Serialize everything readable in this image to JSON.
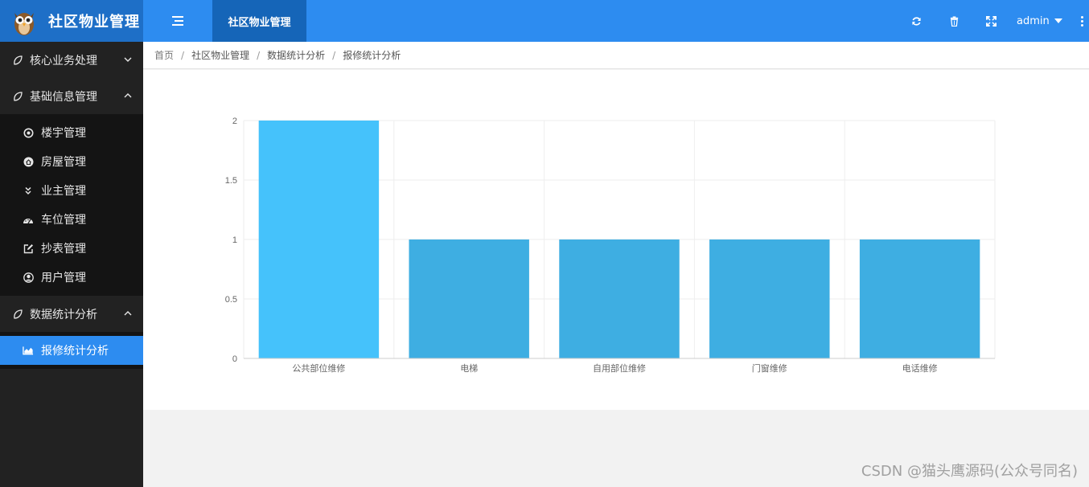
{
  "header": {
    "brand_title": "社区物业管理",
    "top_tab": "社区物业管理",
    "user_name": "admin",
    "icons": [
      "menu-icon",
      "refresh-icon",
      "trash-icon",
      "fullscreen-icon",
      "more-vertical-icon"
    ],
    "accent_color": "#2d8cf0",
    "brand_bg": "#1e6fc7"
  },
  "sidebar": {
    "groups": [
      {
        "label": "核心业务处理",
        "expanded": false
      },
      {
        "label": "基础信息管理",
        "expanded": true,
        "items": [
          {
            "label": "楼宇管理",
            "icon": "target-icon"
          },
          {
            "label": "房屋管理",
            "icon": "home-icon"
          },
          {
            "label": "业主管理",
            "icon": "double-chevron-down-icon"
          },
          {
            "label": "车位管理",
            "icon": "dashboard-icon"
          },
          {
            "label": "抄表管理",
            "icon": "edit-icon"
          },
          {
            "label": "用户管理",
            "icon": "user-circle-icon"
          }
        ]
      },
      {
        "label": "数据统计分析",
        "expanded": true,
        "items": [
          {
            "label": "报修统计分析",
            "icon": "area-chart-icon",
            "active": true
          }
        ]
      }
    ]
  },
  "breadcrumb": [
    "首页",
    "社区物业管理",
    "数据统计分析",
    "报修统计分析"
  ],
  "watermark": "CSDN @猫头鹰源码(公众号同名)",
  "chart_data": {
    "type": "bar",
    "categories": [
      "公共部位维修",
      "电梯",
      "自用部位维修",
      "门窗维修",
      "电话维修"
    ],
    "values": [
      2,
      1,
      1,
      1,
      1
    ],
    "ylim": [
      0,
      2
    ],
    "yticks": [
      "0",
      "0.5",
      "1",
      "1.5",
      "2"
    ],
    "grid": true,
    "bar_colors": [
      "#45c2fb",
      "#3eaee2",
      "#3eaee2",
      "#3eaee2",
      "#3eaee2"
    ]
  }
}
